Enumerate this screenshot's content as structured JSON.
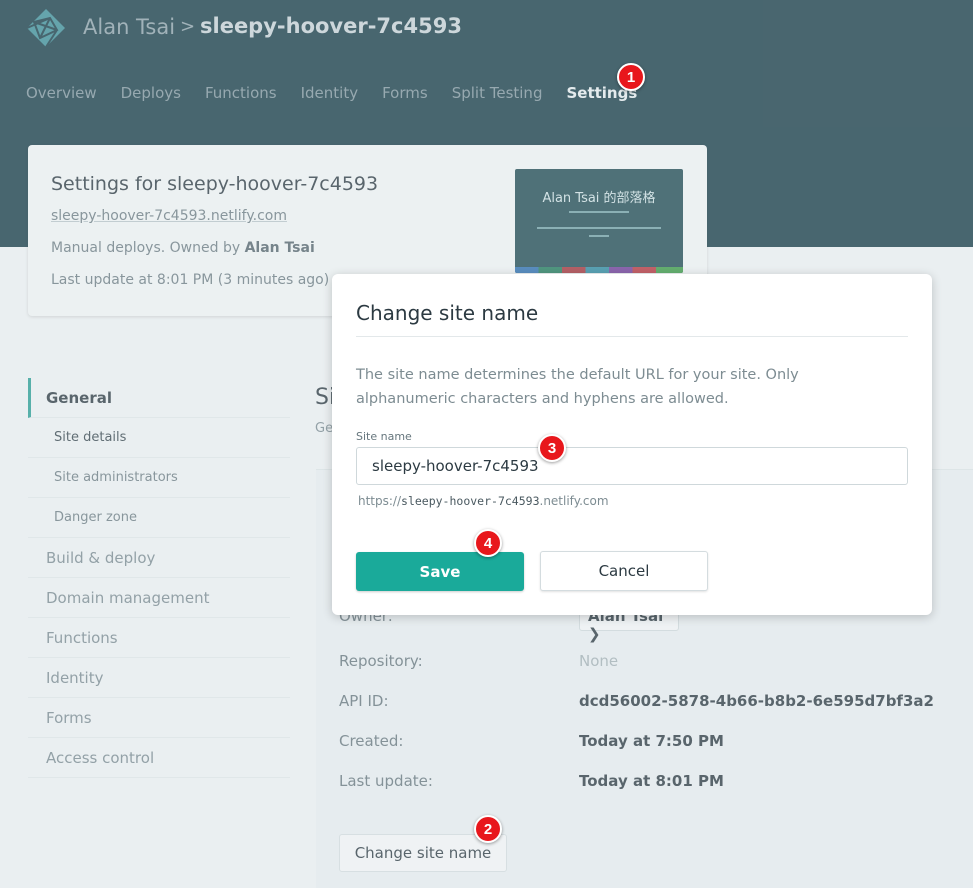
{
  "header": {
    "user": "Alan Tsai",
    "separator": ">",
    "site": "sleepy-hoover-7c4593",
    "logo_icon": "netlify-logo-icon"
  },
  "nav": {
    "tabs": [
      {
        "label": "Overview"
      },
      {
        "label": "Deploys"
      },
      {
        "label": "Functions"
      },
      {
        "label": "Identity"
      },
      {
        "label": "Forms"
      },
      {
        "label": "Split Testing"
      },
      {
        "label": "Settings"
      }
    ],
    "active": "Settings"
  },
  "site_card": {
    "title": "Settings for sleepy-hoover-7c4593",
    "url": "sleepy-hoover-7c4593.netlify.com",
    "meta_prefix": "Manual deploys. Owned by ",
    "owner": "Alan Tsai",
    "last_update": "Last update at 8:01 PM (3 minutes ago)",
    "thumbnail_title": "Alan Tsai 的部落格"
  },
  "sidebar": {
    "section": "General",
    "sub_items": [
      {
        "label": "Site details"
      },
      {
        "label": "Site administrators"
      },
      {
        "label": "Danger zone"
      }
    ],
    "items": [
      {
        "label": "Build & deploy"
      },
      {
        "label": "Domain management"
      },
      {
        "label": "Functions"
      },
      {
        "label": "Identity"
      },
      {
        "label": "Forms"
      },
      {
        "label": "Access control"
      }
    ]
  },
  "main": {
    "title_partial": "Si",
    "subtitle_partial": "Ge",
    "rows": [
      {
        "label": "Owner:",
        "value": "Alan Tsai"
      },
      {
        "label": "Repository:",
        "value": "None"
      },
      {
        "label": "API ID:",
        "value": "dcd56002-5878-4b66-b8b2-6e595d7bf3a2"
      },
      {
        "label": "Created:",
        "value": "Today at 7:50 PM"
      },
      {
        "label": "Last update:",
        "value": "Today at 8:01 PM"
      }
    ],
    "change_button": "Change site name"
  },
  "modal": {
    "title": "Change site name",
    "description": "The site name determines the default URL for your site. Only alphanumeric characters and hyphens are allowed.",
    "field_label": "Site name",
    "field_value": "sleepy-hoover-7c4593",
    "url_prefix": "https://",
    "url_site": "sleepy-hoover-7c4593",
    "url_suffix": ".netlify.com",
    "save": "Save",
    "cancel": "Cancel"
  },
  "annotations": [
    {
      "number": "1"
    },
    {
      "number": "2"
    },
    {
      "number": "3"
    },
    {
      "number": "4"
    }
  ],
  "colors": {
    "header_bg": "#163b46",
    "accent": "#1aaa9a",
    "badge": "#e8171c"
  }
}
